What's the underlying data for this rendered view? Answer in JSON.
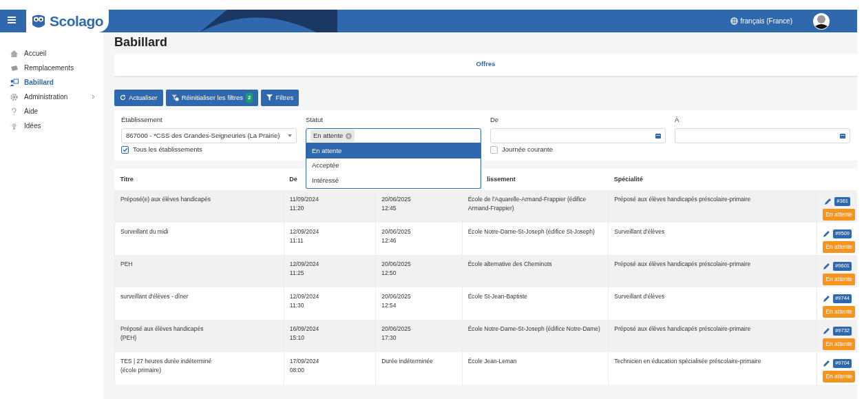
{
  "header": {
    "brand": "Scolago",
    "language": "français (France)"
  },
  "sidebar": {
    "items": [
      {
        "label": "Accueil",
        "selected": false,
        "has_submenu": false
      },
      {
        "label": "Remplacements",
        "selected": false,
        "has_submenu": false
      },
      {
        "label": "Babillard",
        "selected": true,
        "has_submenu": false
      },
      {
        "label": "Administration",
        "selected": false,
        "has_submenu": true
      },
      {
        "label": "Aide",
        "selected": false,
        "has_submenu": false
      },
      {
        "label": "Idées",
        "selected": false,
        "has_submenu": false
      }
    ]
  },
  "page_title": "Babillard",
  "tabs": [
    {
      "label": "Offres",
      "selected": true
    }
  ],
  "toolbar": {
    "buttons": [
      {
        "kind": "refresh",
        "label": "Actualiser"
      },
      {
        "kind": "reset",
        "label": "Réinitialiser les filtres",
        "badge": "2"
      },
      {
        "kind": "filter",
        "label": "Filtres"
      }
    ]
  },
  "filters": {
    "etablissement": {
      "label": "Établissement",
      "value": "867000 - *CSS des Grandes-Seigneuries (La Prairie)",
      "checkbox": {
        "label": "Tous les établissements",
        "checked": true
      }
    },
    "statut": {
      "label": "Statut",
      "tags": [
        "En attente"
      ],
      "expanded": true,
      "options": [
        {
          "label": "En attente",
          "selected": true
        },
        {
          "label": "Acceptée",
          "selected": false
        },
        {
          "label": "Intéressé",
          "selected": false
        }
      ]
    },
    "de": {
      "label": "De",
      "checkbox": {
        "label": "Journée courante",
        "checked": false
      }
    },
    "a": {
      "label": "À"
    }
  },
  "table": {
    "columns": {
      "titre": "Titre",
      "de": "De",
      "etablissement": "lissement",
      "specialite": "Spécialité"
    },
    "rows": [
      {
        "titre": "Préposé(e) aux élèves handicapés",
        "de": "11/09/2024\n11:20",
        "a": "20/06/2025\n12:45",
        "etablissement": "École de l'Aquarelle-Armand-Frappier (édifice Armand-Frappier)",
        "specialite": "Préposé aux élèves handicapés préscolaire-primaire",
        "number": "#361",
        "status": "En attente"
      },
      {
        "titre": "Surveillant du midi",
        "de": "12/09/2024\n11:11",
        "a": "20/06/2025\n12:46",
        "etablissement": "École Notre-Dame-St-Joseph (édifice St-Joseph)",
        "specialite": "Surveillant d'élèves",
        "number": "#9509",
        "status": "En attente"
      },
      {
        "titre": "PEH",
        "de": "12/09/2024\n11:25",
        "a": "20/06/2025\n12:50",
        "etablissement": "École alternative des Cheminots",
        "specialite": "Préposé aux élèves handicapés préscolaire-primaire",
        "number": "#9601",
        "status": "En attente"
      },
      {
        "titre": "surveillant d'élèves - dîner",
        "de": "12/09/2024\n11:30",
        "a": "20/06/2025\n12:54",
        "etablissement": "École St-Jean-Baptiste",
        "specialite": "Surveillant d'élèves",
        "number": "#9744",
        "status": "En attente"
      },
      {
        "titre": "Préposé aux élèves handicapés\n(PEH)",
        "de": "16/09/2024\n15:10",
        "a": "20/06/2025\n17:30",
        "etablissement": "École Notre-Dame-St-Joseph (édifice Notre-Dame)",
        "specialite": "Préposé aux élèves handicapés préscolaire-primaire",
        "number": "#9732",
        "status": "En attente"
      },
      {
        "titre": "TES | 27 heures durée indéterminé\n(école primaire)",
        "de": "17/09/2024\n08:00",
        "a": "Durée indéterminée",
        "etablissement": "École Jean-Leman",
        "specialite": "Technicien en éducation spécialisée préscolaire-primaire",
        "number": "#9704",
        "status": "En attente"
      }
    ]
  }
}
